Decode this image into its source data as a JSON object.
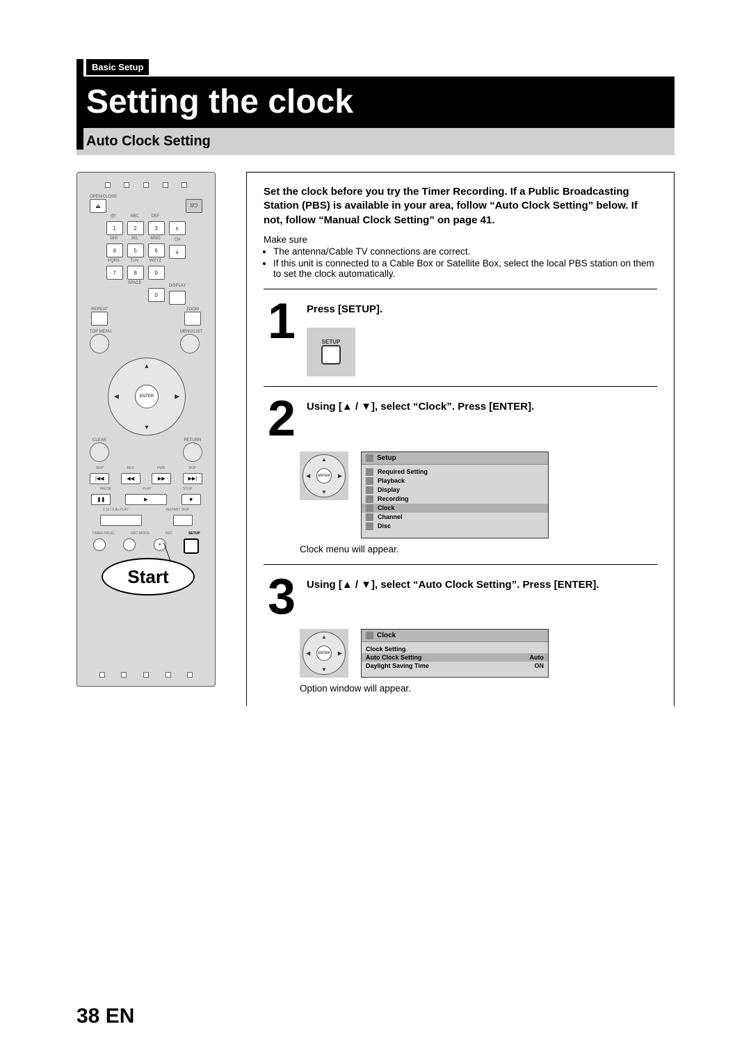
{
  "breadcrumb": "Basic Setup",
  "title": "Setting the clock",
  "subheader": "Auto Clock Setting",
  "remote": {
    "open_close": "OPEN/CLOSE",
    "power": "I/Ⓞ",
    "key_labels_row1": [
      "@!:",
      "ABC",
      "DEF"
    ],
    "keys_row1": [
      "1",
      "2",
      "3"
    ],
    "key_labels_row2": [
      "GHI",
      "JKL",
      "MNO"
    ],
    "keys_row2": [
      "4",
      "5",
      "6"
    ],
    "key_labels_row3": [
      "PQRS",
      "TUV",
      "WXYZ"
    ],
    "keys_row3": [
      "7",
      "8",
      "9"
    ],
    "space": "SPACE",
    "zero": "0",
    "display": "DISPLAY",
    "ch": "CH",
    "repeat": "REPEAT",
    "zoom": "ZOOM",
    "top_menu": "TOP MENU",
    "menu_list": "MENU/LIST",
    "enter": "ENTER",
    "clear": "CLEAR",
    "return": "RETURN",
    "skip_l": "SKIP",
    "rev": "REV",
    "fwd": "FWD",
    "skip_r": "SKIP",
    "pause": "PAUSE",
    "play": "PLAY",
    "stop": "STOP",
    "speed": "1.3x / 0.8x PLAY",
    "instant": "INSTANT SKIP",
    "timer_prog": "TIMER PROG.",
    "rec_mode": "REC MODE",
    "rec": "REC",
    "setup": "SETUP",
    "callout": "Start"
  },
  "intro": "Set the clock before you try the Timer Recording. If a Public Broadcasting Station (PBS) is available in your area, follow “Auto Clock Setting” below. If not, follow “Manual Clock Setting” on page 41.",
  "makesure_title": "Make sure",
  "makesure_items": [
    "The antenna/Cable TV connections are correct.",
    "If this unit is connected to a Cable Box or Satellite Box, select the local PBS station on them to set the clock automatically."
  ],
  "steps": {
    "s1": {
      "num": "1",
      "title": "Press [SETUP].",
      "icon_label": "SETUP"
    },
    "s2": {
      "num": "2",
      "title": "Using [▲ / ▼], select “Clock”. Press [ENTER].",
      "screen_title": "Setup",
      "menu": [
        "Required Setting",
        "Playback",
        "Display",
        "Recording",
        "Clock",
        "Channel",
        "Disc"
      ],
      "selected": "Clock",
      "caption": "Clock menu will appear."
    },
    "s3": {
      "num": "3",
      "title": "Using [▲ / ▼], select “Auto Clock Setting”. Press [ENTER].",
      "screen_title": "Clock",
      "rows": [
        {
          "label": "Clock Setting",
          "value": ""
        },
        {
          "label": "Auto Clock Setting",
          "value": "Auto"
        },
        {
          "label": "Daylight Saving Time",
          "value": "ON"
        }
      ],
      "selected": "Auto Clock Setting",
      "caption": "Option window will appear."
    }
  },
  "footer": {
    "page": "38",
    "lang": "EN"
  }
}
